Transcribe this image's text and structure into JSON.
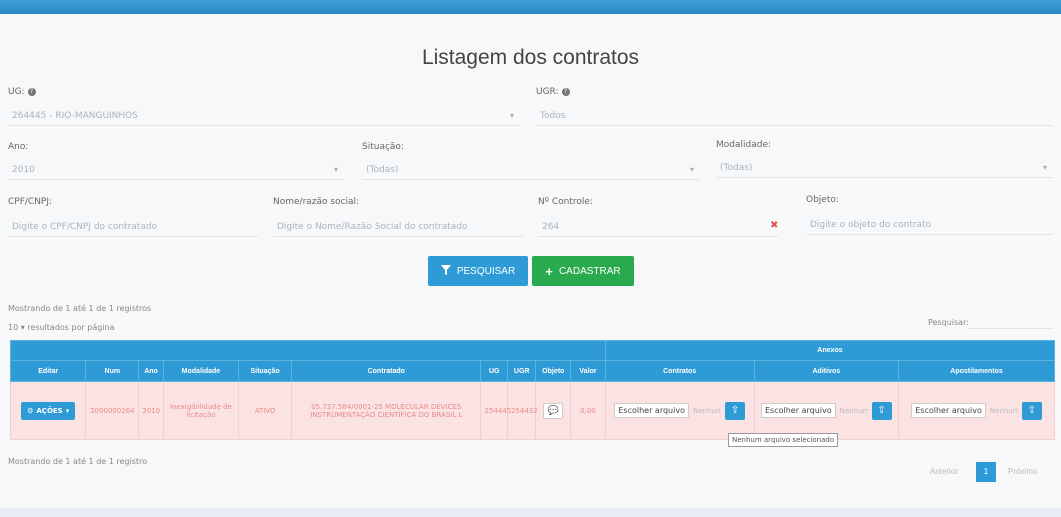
{
  "header": {
    "title": "Listagem dos contratos"
  },
  "filters": {
    "ug": {
      "label": "UG:",
      "value": "264445 - RIO-MANGUINHOS"
    },
    "ugr": {
      "label": "UGR:",
      "value": "Todos"
    },
    "ano": {
      "label": "Ano:",
      "value": "2010"
    },
    "situacao": {
      "label": "Situação:",
      "value": "(Todas)"
    },
    "modalidade": {
      "label": "Modalidade:",
      "value": "(Todas)"
    },
    "cpf": {
      "label": "CPF/CNPJ:",
      "placeholder": "Digite o CPF/CNPJ do contratado"
    },
    "nome": {
      "label": "Nome/razão social:",
      "placeholder": "Digite o Nome/Razão Social do contratado"
    },
    "controle": {
      "label": "Nº Controle:",
      "value": "264"
    },
    "objeto": {
      "label": "Objeto:",
      "placeholder": "Digite o objeto do contrato"
    }
  },
  "buttons": {
    "search": "PESQUISAR",
    "add": "CADASTRAR"
  },
  "info_top": "Mostrando de 1 até 1 de 1 registros",
  "page_size": "10 ▾ resultados por página",
  "table_search": "Pesquisar:",
  "table": {
    "group_header": "Anexos",
    "columns": [
      "Editar",
      "Num",
      "Ano",
      "Modalidade",
      "Situação",
      "Contratado",
      "UG",
      "UGR",
      "Objeto",
      "Valor",
      "Contratos",
      "Aditivos",
      "Apostilamentos"
    ],
    "row": {
      "acoes": "AÇÕES",
      "num": "2000000264",
      "ano": "2010",
      "modalidade": "Inexigibilidade de licitação",
      "situacao": "ATIVO",
      "contratado": "05.737.584/0001-25 MOLECULAR DEVICES INSTRUMENTAÇÃO CIENTÍFICA DO BRASIL L",
      "ug": "254445",
      "ugr": "254432",
      "valor": "0,00",
      "file_button": "Escolher arquivo",
      "file_none": "Nenhum arquivo"
    }
  },
  "tooltip": "Nenhum arquivo selecionado",
  "info_bottom": "Mostrando de 1 até 1 de 1 registro",
  "pagination": {
    "prev": "Anterior",
    "current": "1",
    "next": "Próximo"
  },
  "icons": {
    "filter": "filter-icon",
    "plus": "plus-icon",
    "upload": "upload-icon",
    "comment": "comment-icon",
    "cogs": "cogs-icon"
  }
}
